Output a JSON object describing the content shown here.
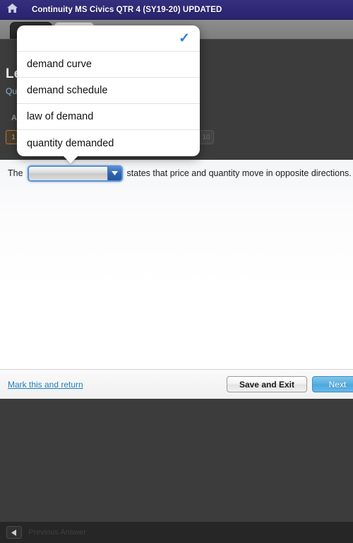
{
  "topbar": {
    "home_icon": "home-icon",
    "title": "Continuity MS Civics QTR 4 (SY19-20) UPDATED"
  },
  "browser_chrome": {
    "tabs": [
      {
        "label": "",
        "active": true
      },
      {
        "label": "",
        "active": false
      }
    ]
  },
  "lesson_panel": {
    "title": "Le",
    "subtitle": "Qu",
    "section_letter": "A",
    "question_nav": {
      "first": "1",
      "last": "10"
    }
  },
  "dropdown_popup": {
    "options": [
      {
        "label": "",
        "selected": true
      },
      {
        "label": "demand curve",
        "selected": false
      },
      {
        "label": "demand schedule",
        "selected": false
      },
      {
        "label": "law of demand",
        "selected": false
      },
      {
        "label": "quantity demanded",
        "selected": false
      }
    ],
    "check_icon": "checkmark-icon",
    "check_color": "#2a7cf0"
  },
  "question": {
    "text_before": "The",
    "text_after": "states that price and quantity move in opposite directions.",
    "select": {
      "value": "",
      "placeholder": "",
      "arrow_icon": "chevron-down-icon",
      "focus_color": "#5b93d6",
      "arrow_button_color": "#2f63ab"
    }
  },
  "footer": {
    "mark_link": "Mark this and return",
    "save_label": "Save and Exit",
    "next_label": "Next",
    "link_color": "#1f7fbd",
    "next_color": "#55ade0"
  },
  "bottom_toolbar": {
    "prev_icon": "back-arrow-icon",
    "prev_label": "Previous Answer"
  }
}
